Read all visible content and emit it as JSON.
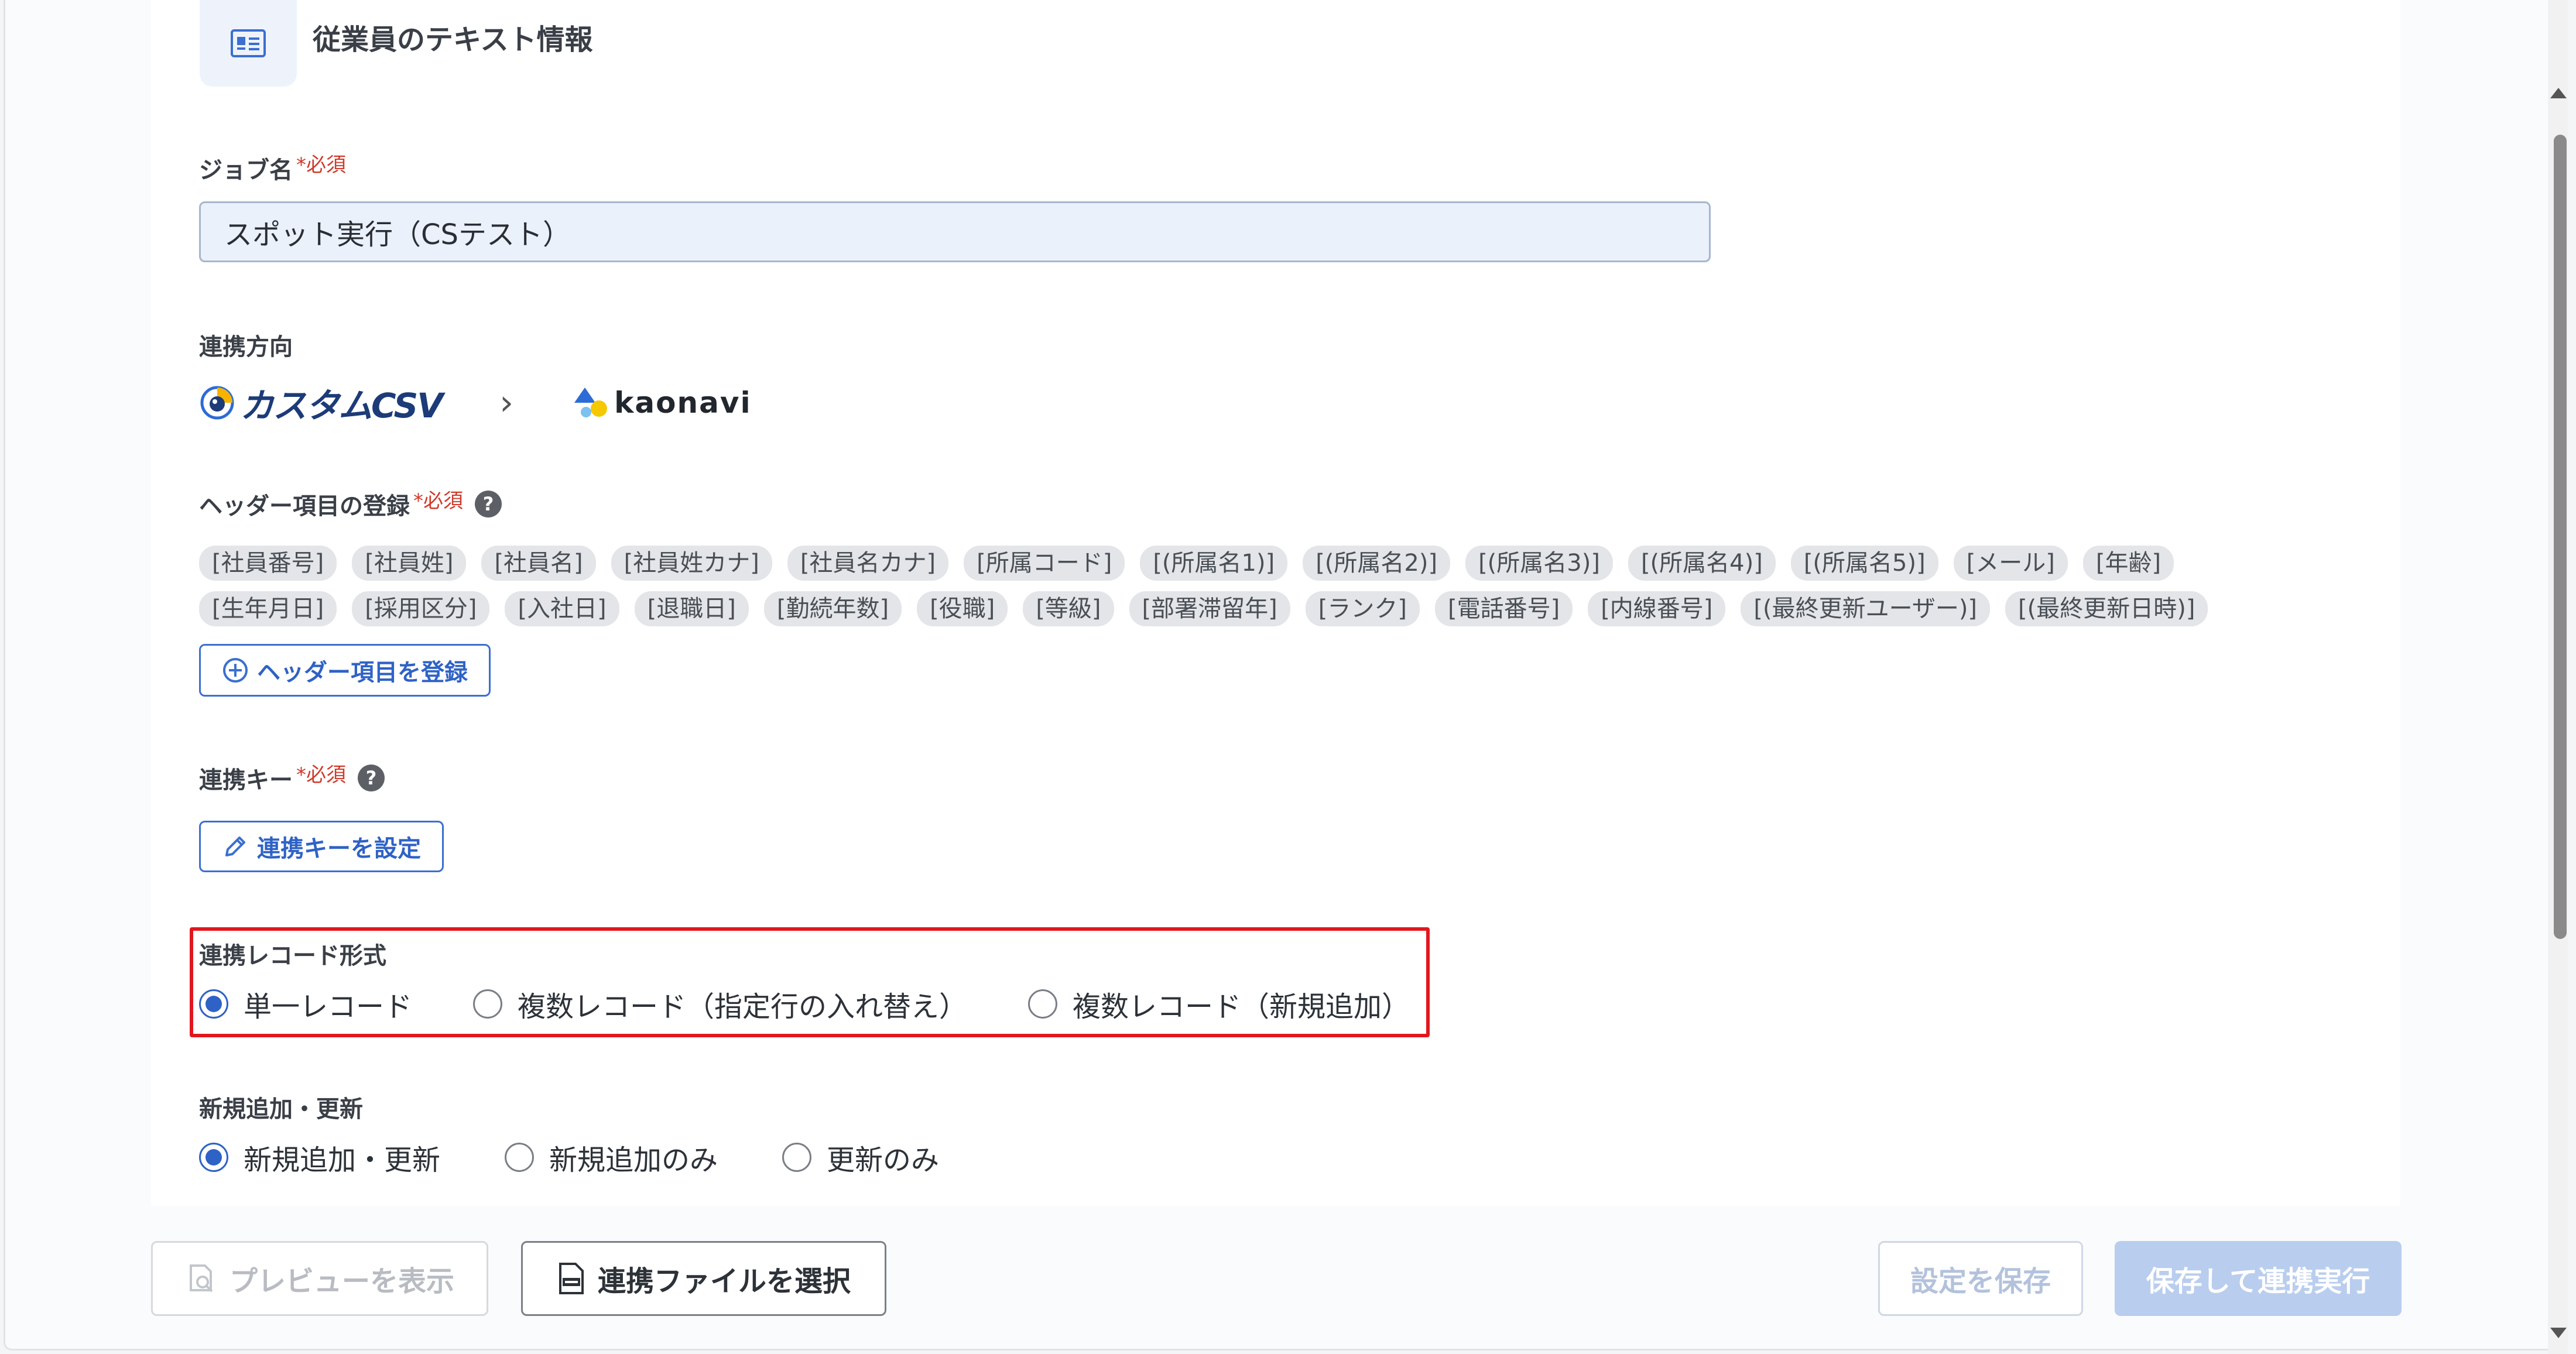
{
  "section": {
    "title": "従業員のテキスト情報",
    "icon": "id-card-icon"
  },
  "job_name": {
    "label": "ジョブ名",
    "required": "*必須",
    "value": "スポット実行（CSテスト）"
  },
  "direction": {
    "label": "連携方向",
    "source": "カスタムCSV",
    "arrow": "›",
    "target": "kaonavi"
  },
  "headers": {
    "label": "ヘッダー項目の登録",
    "required": "*必須",
    "tags": [
      "[社員番号]",
      "[社員姓]",
      "[社員名]",
      "[社員姓カナ]",
      "[社員名カナ]",
      "[所属コード]",
      "[(所属名1)]",
      "[(所属名2)]",
      "[(所属名3)]",
      "[(所属名4)]",
      "[(所属名5)]",
      "[メール]",
      "[年齢]",
      "[生年月日]",
      "[採用区分]",
      "[入社日]",
      "[退職日]",
      "[勤続年数]",
      "[役職]",
      "[等級]",
      "[部署滞留年]",
      "[ランク]",
      "[電話番号]",
      "[内線番号]",
      "[(最終更新ユーザー)]",
      "[(最終更新日時)]"
    ],
    "add_button": "ヘッダー項目を登録"
  },
  "key": {
    "label": "連携キー",
    "required": "*必須",
    "button": "連携キーを設定"
  },
  "record_format": {
    "label": "連携レコード形式",
    "options": [
      "単一レコード",
      "複数レコード（指定行の入れ替え）",
      "複数レコード（新規追加）"
    ],
    "selected": 0
  },
  "update_mode": {
    "label": "新規追加・更新",
    "options": [
      "新規追加・更新",
      "新規追加のみ",
      "更新のみ"
    ],
    "selected": 0
  },
  "footer": {
    "preview": "プレビューを表示",
    "select_file": "連携ファイルを選択",
    "save": "設定を保存",
    "save_run": "保存して連携実行"
  },
  "help_glyph": "?",
  "colors": {
    "accent": "#2f62c6",
    "required": "#d13a2b",
    "highlight": "#e2171e",
    "run_disabled": "#b9cdee"
  }
}
